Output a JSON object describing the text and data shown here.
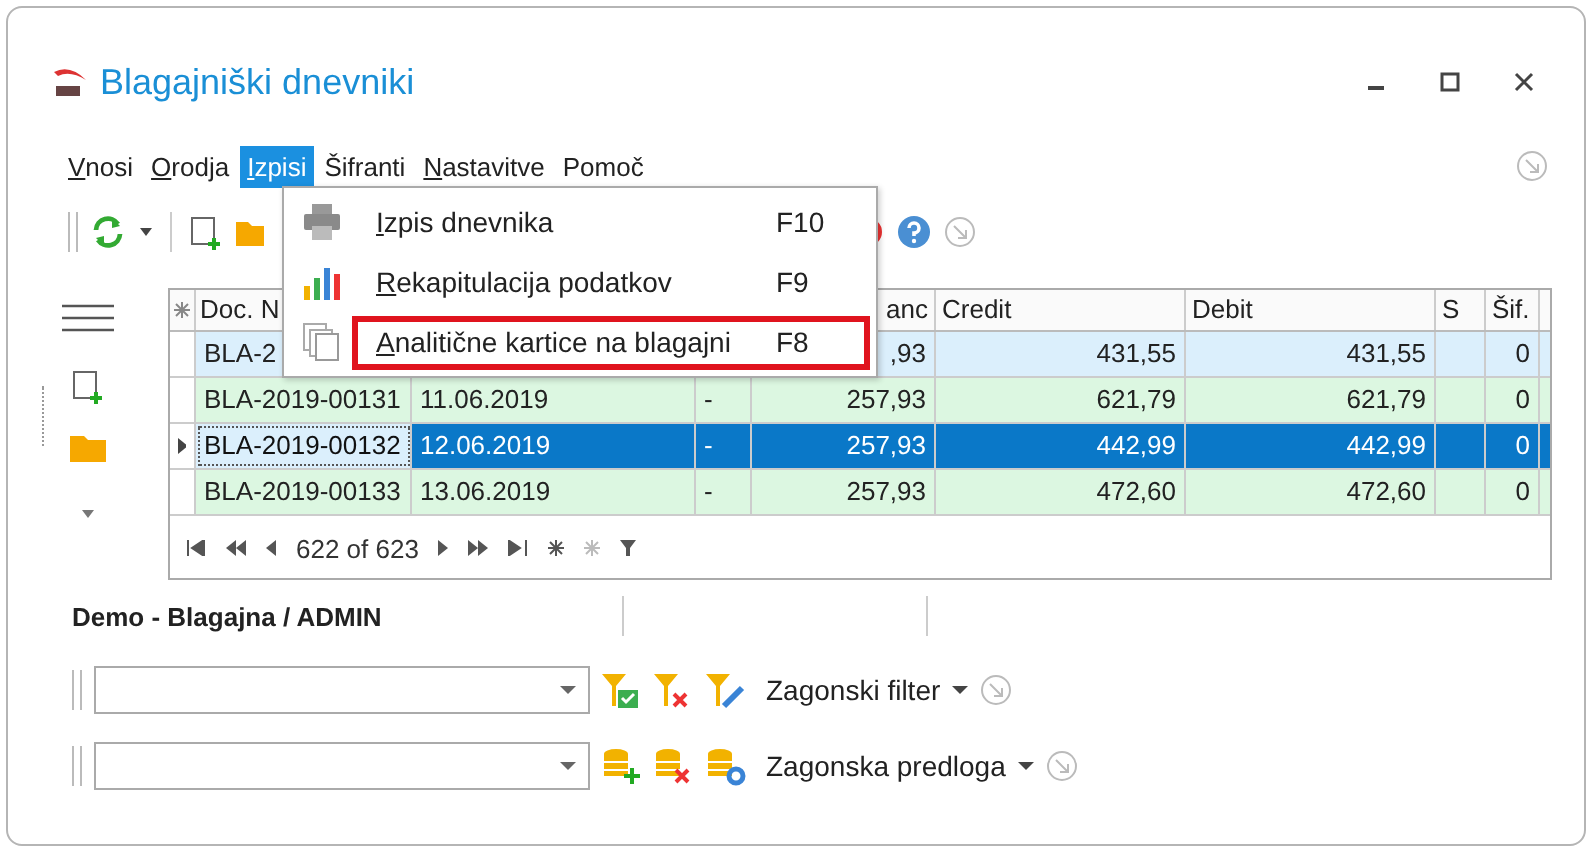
{
  "window": {
    "title": "Blagajniški dnevniki"
  },
  "menu_bar": [
    {
      "label": "Vnosi",
      "underline_first": true,
      "selected": false
    },
    {
      "label": "Orodja",
      "underline_first": true,
      "selected": false
    },
    {
      "label": "Izpisi",
      "underline_first": true,
      "selected": true
    },
    {
      "label": "Šifranti",
      "underline_first": false,
      "selected": false
    },
    {
      "label": "Nastavitve",
      "underline_first": true,
      "selected": false
    },
    {
      "label": "Pomoč",
      "underline_first": false,
      "selected": false
    }
  ],
  "dropdown": [
    {
      "kind": "printer",
      "label": "Izpis dnevnika",
      "shortcut": "F10",
      "highlighted": false
    },
    {
      "kind": "chart",
      "label": "Rekapitulacija podatkov",
      "shortcut": "F9",
      "highlighted": false
    },
    {
      "kind": "copies",
      "label": "Analitične kartice na blagajni",
      "shortcut": "F8",
      "highlighted": true
    }
  ],
  "table": {
    "columns": [
      "Doc. N",
      "",
      "",
      "anc",
      "Credit",
      "Debit",
      "S",
      "Šif."
    ],
    "rows": [
      {
        "selected": false,
        "color": "#dbeffc",
        "cells": [
          "BLA-2",
          "",
          "",
          ",93",
          "431,55",
          "431,55",
          "",
          "0"
        ]
      },
      {
        "selected": false,
        "color": "#dcf7e1",
        "cells": [
          "BLA-2019-00131",
          "11.06.2019",
          "-",
          "257,93",
          "621,79",
          "621,79",
          "",
          "0"
        ]
      },
      {
        "selected": true,
        "cells": [
          "BLA-2019-00132",
          "12.06.2019",
          "-",
          "257,93",
          "442,99",
          "442,99",
          "",
          "0"
        ]
      },
      {
        "selected": false,
        "color": "#dcf7e1",
        "cells": [
          "BLA-2019-00133",
          "13.06.2019",
          "-",
          "257,93",
          "472,60",
          "472,60",
          "",
          "0"
        ]
      }
    ],
    "navigator": "622 of 623"
  },
  "status_label": "Demo - Blagajna / ADMIN",
  "filter_bar": {
    "label": "Zagonski filter"
  },
  "template_bar": {
    "label": "Zagonska predloga"
  }
}
